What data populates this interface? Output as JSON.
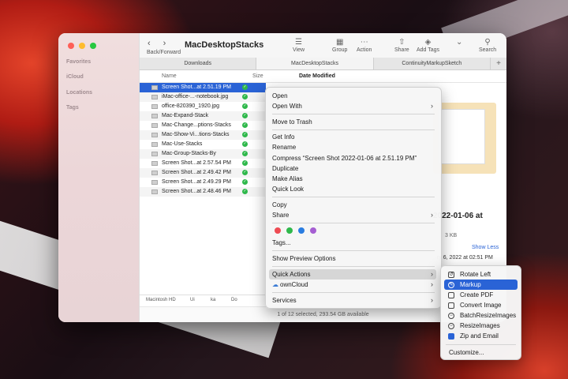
{
  "window": {
    "title": "MacDesktopStacks",
    "nav_label": "Back/Forward",
    "toolbar": {
      "view": "View",
      "group": "Group",
      "action": "Action",
      "share": "Share",
      "add_tags": "Add Tags",
      "search": "Search"
    },
    "tabs": [
      "Downloads",
      "MacDesktopStacks",
      "ContinuityMarkupSketch"
    ],
    "tab_plus": "+",
    "sidebar": [
      "Favorites",
      "iCloud",
      "Locations",
      "Tags"
    ],
    "columns": {
      "name": "Name",
      "size": "Size",
      "date": "Date Modified"
    },
    "files": [
      "Screen Shot...at 2.51.19 PM",
      "iMac-office-...-notebook.jpg",
      "office-820390_1920.jpg",
      "Mac-Expand-Stack",
      "Mac-Change...ptions-Stacks",
      "Mac-Show-Vi...tions-Stacks",
      "Mac-Use-Stacks",
      "Mac-Group-Stacks-By",
      "Screen Shot...at 2.57.54 PM",
      "Screen Shot...at 2.49.42 PM",
      "Screen Shot...at 2.49.29 PM",
      "Screen Shot...at 2.48.46 PM"
    ],
    "preview": {
      "date_fragment": "2022-01-06 at",
      "size_fragment": "3 KB",
      "show_less": "Show Less",
      "modified_fragment": "ry 6, 2022 at 02:51 PM"
    },
    "path": [
      "Macintosh HD",
      "Ui",
      "ka",
      "Do"
    ],
    "status": "1 of 12 selected, 293.54 GB available"
  },
  "context_menu": {
    "items": [
      "Open",
      "Open With",
      "Move to Trash",
      "Get Info",
      "Rename",
      "Compress “Screen Shot 2022-01-06 at 2.51.19 PM”",
      "Duplicate",
      "Make Alias",
      "Quick Look",
      "Copy",
      "Share",
      "Tags...",
      "Show Preview Options",
      "Quick Actions",
      "ownCloud",
      "Services"
    ],
    "chevron": "›",
    "tag_colors": [
      "#ee4b53",
      "#2fb84b",
      "#2a7de1",
      "#a55ed2"
    ]
  },
  "quick_actions": {
    "items": [
      "Rotate Left",
      "Markup",
      "Create PDF",
      "Convert Image",
      "BatchResizeImages",
      "ResizeImages",
      "Zip and Email",
      "Customize..."
    ]
  }
}
